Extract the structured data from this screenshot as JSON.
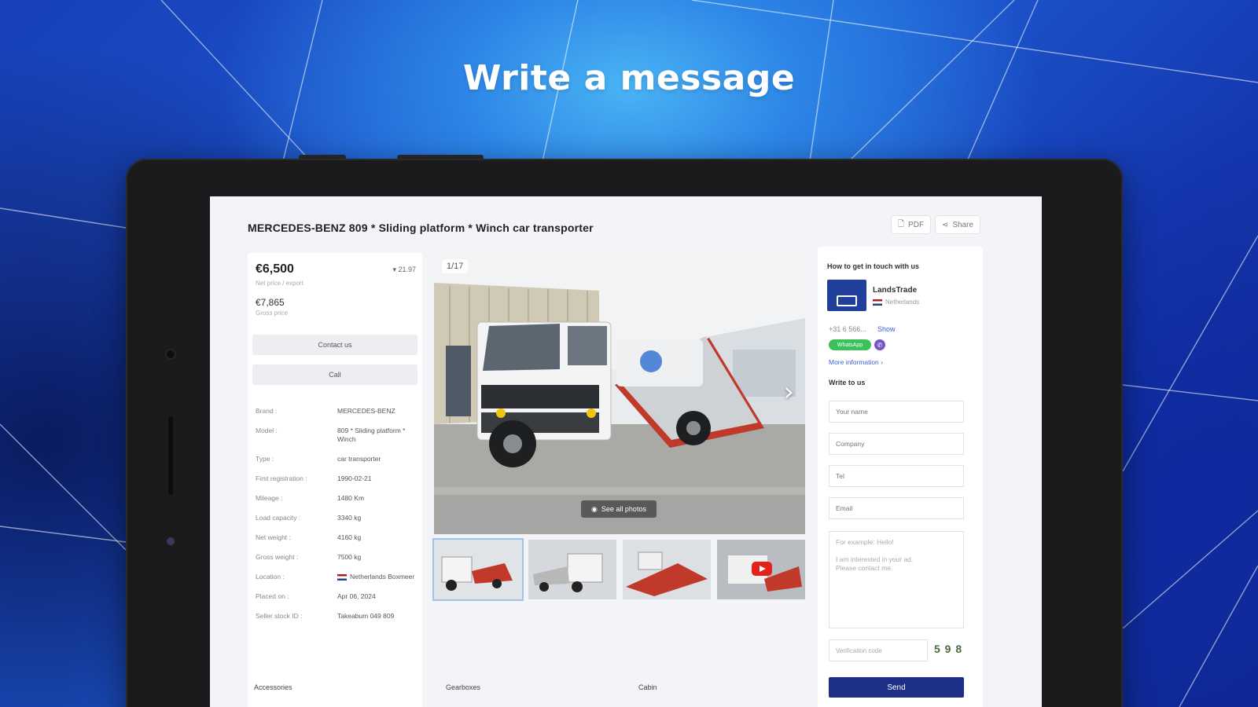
{
  "headline": "Write a message",
  "listing": {
    "title": "MERCEDES-BENZ 809 * Sliding platform * Winch car transporter",
    "toolbar": {
      "pdf_label": "PDF",
      "share_label": "Share"
    },
    "price": "€6,500",
    "price_note": "Net price / export",
    "price_change": "▾ 21.97",
    "gross_price": "€7,865",
    "gross_note": "Gross price",
    "contact_button": "Contact us",
    "call_button": "Call",
    "specs": [
      {
        "key": "Brand :",
        "value": "MERCEDES-BENZ"
      },
      {
        "key": "Model :",
        "value": "809 * Sliding platform * Winch"
      },
      {
        "key": "Type :",
        "value": "car transporter"
      },
      {
        "key": "First registration :",
        "value": "1990-02-21"
      },
      {
        "key": "Mileage :",
        "value": "1480 Km"
      },
      {
        "key": "Load capacity :",
        "value": "3340 kg"
      },
      {
        "key": "Net weight :",
        "value": "4160 kg"
      },
      {
        "key": "Gross weight :",
        "value": "7500 kg"
      },
      {
        "key": "Location :",
        "value": "Netherlands Boxmeer"
      },
      {
        "key": "Placed on :",
        "value": "Apr 06, 2024"
      },
      {
        "key": "Seller stock ID :",
        "value": "Takeabum 049 809"
      }
    ],
    "bottom_tabs": [
      "Accessories",
      "Gearboxes",
      "Cabin"
    ]
  },
  "gallery": {
    "counter": "1/17",
    "see_all_label": "See all photos",
    "thumbnails": [
      "thumb-1",
      "thumb-2",
      "thumb-3",
      "thumb-video"
    ]
  },
  "contact": {
    "heading": "How to get in touch with us",
    "seller_name": "LandsTrade",
    "seller_country": "Netherlands",
    "phone": "+31 6 566...",
    "show_label": "Show",
    "whatsapp_label": "WhatsApp",
    "more_info": "More information ›",
    "write_heading": "Write to us",
    "form": {
      "name_placeholder": "Your name",
      "company_placeholder": "Company",
      "tel_placeholder": "Tel",
      "email_placeholder": "Email",
      "message_placeholder": "For example: Hello!\n\nI am interested in your ad.\nPlease contact me.",
      "captcha_placeholder": "Verification code",
      "captcha_text": "5 9 8",
      "send_label": "Send"
    }
  },
  "colors": {
    "accent": "#1d2f86",
    "link": "#3b63d3",
    "whatsapp": "#3bc15b",
    "viber": "#7357c7"
  }
}
